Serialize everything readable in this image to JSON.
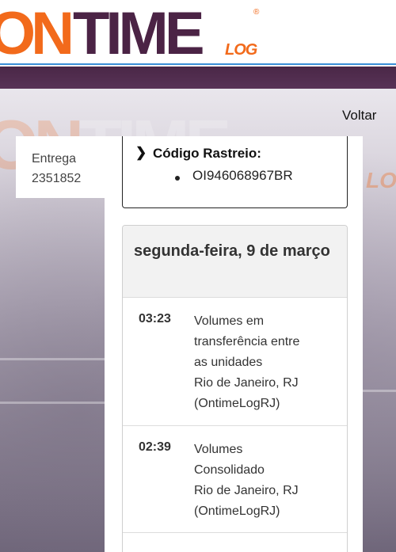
{
  "header": {
    "logo_on": "ON",
    "logo_time": "TIME",
    "logo_log": "LOG",
    "logo_reg": "®"
  },
  "colors": {
    "brand_orange": "#f26a1b",
    "brand_purple": "#4b2345",
    "accent_blue": "#3a8fd6"
  },
  "nav": {
    "back_label": "Voltar"
  },
  "delivery": {
    "label": "Entrega",
    "number": "2351852"
  },
  "tracking": {
    "title": "Código Rastreio:",
    "codes": [
      "OI946068967BR"
    ]
  },
  "timeline": {
    "date": "segunda-feira, 9 de março",
    "events": [
      {
        "time": "03:23",
        "lines": [
          "Volumes em",
          "transferência entre",
          "as unidades",
          "Rio de Janeiro, RJ",
          "(OntimeLogRJ)"
        ]
      },
      {
        "time": "02:39",
        "lines": [
          "Volumes",
          "Consolidado",
          "Rio de Janeiro, RJ",
          "(OntimeLogRJ)"
        ]
      }
    ]
  }
}
